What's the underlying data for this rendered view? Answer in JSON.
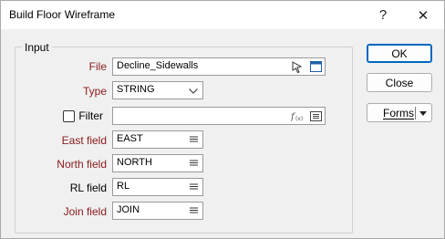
{
  "window": {
    "title": "Build Floor Wireframe",
    "help_label": "?",
    "close_label": "✕"
  },
  "group": {
    "title": "Input"
  },
  "fields": {
    "file": {
      "label": "File",
      "value": "Decline_Sidewalls"
    },
    "type": {
      "label": "Type",
      "value": "STRING"
    },
    "filter": {
      "label": "Filter",
      "value": "",
      "checked": false
    },
    "east": {
      "label": "East field",
      "value": "EAST"
    },
    "north": {
      "label": "North field",
      "value": "NORTH"
    },
    "rl": {
      "label": "RL field",
      "value": "RL"
    },
    "join": {
      "label": "Join field",
      "value": "JOIN"
    }
  },
  "buttons": {
    "ok": "OK",
    "close": "Close",
    "forms": "Forms"
  },
  "colors": {
    "required_label": "#8b1a1a",
    "accent": "#0067c0"
  },
  "icons": [
    "pointer-icon",
    "browse-icon",
    "chevron-down-icon",
    "function-icon",
    "list-icon",
    "dropdown-arrow-icon"
  ]
}
